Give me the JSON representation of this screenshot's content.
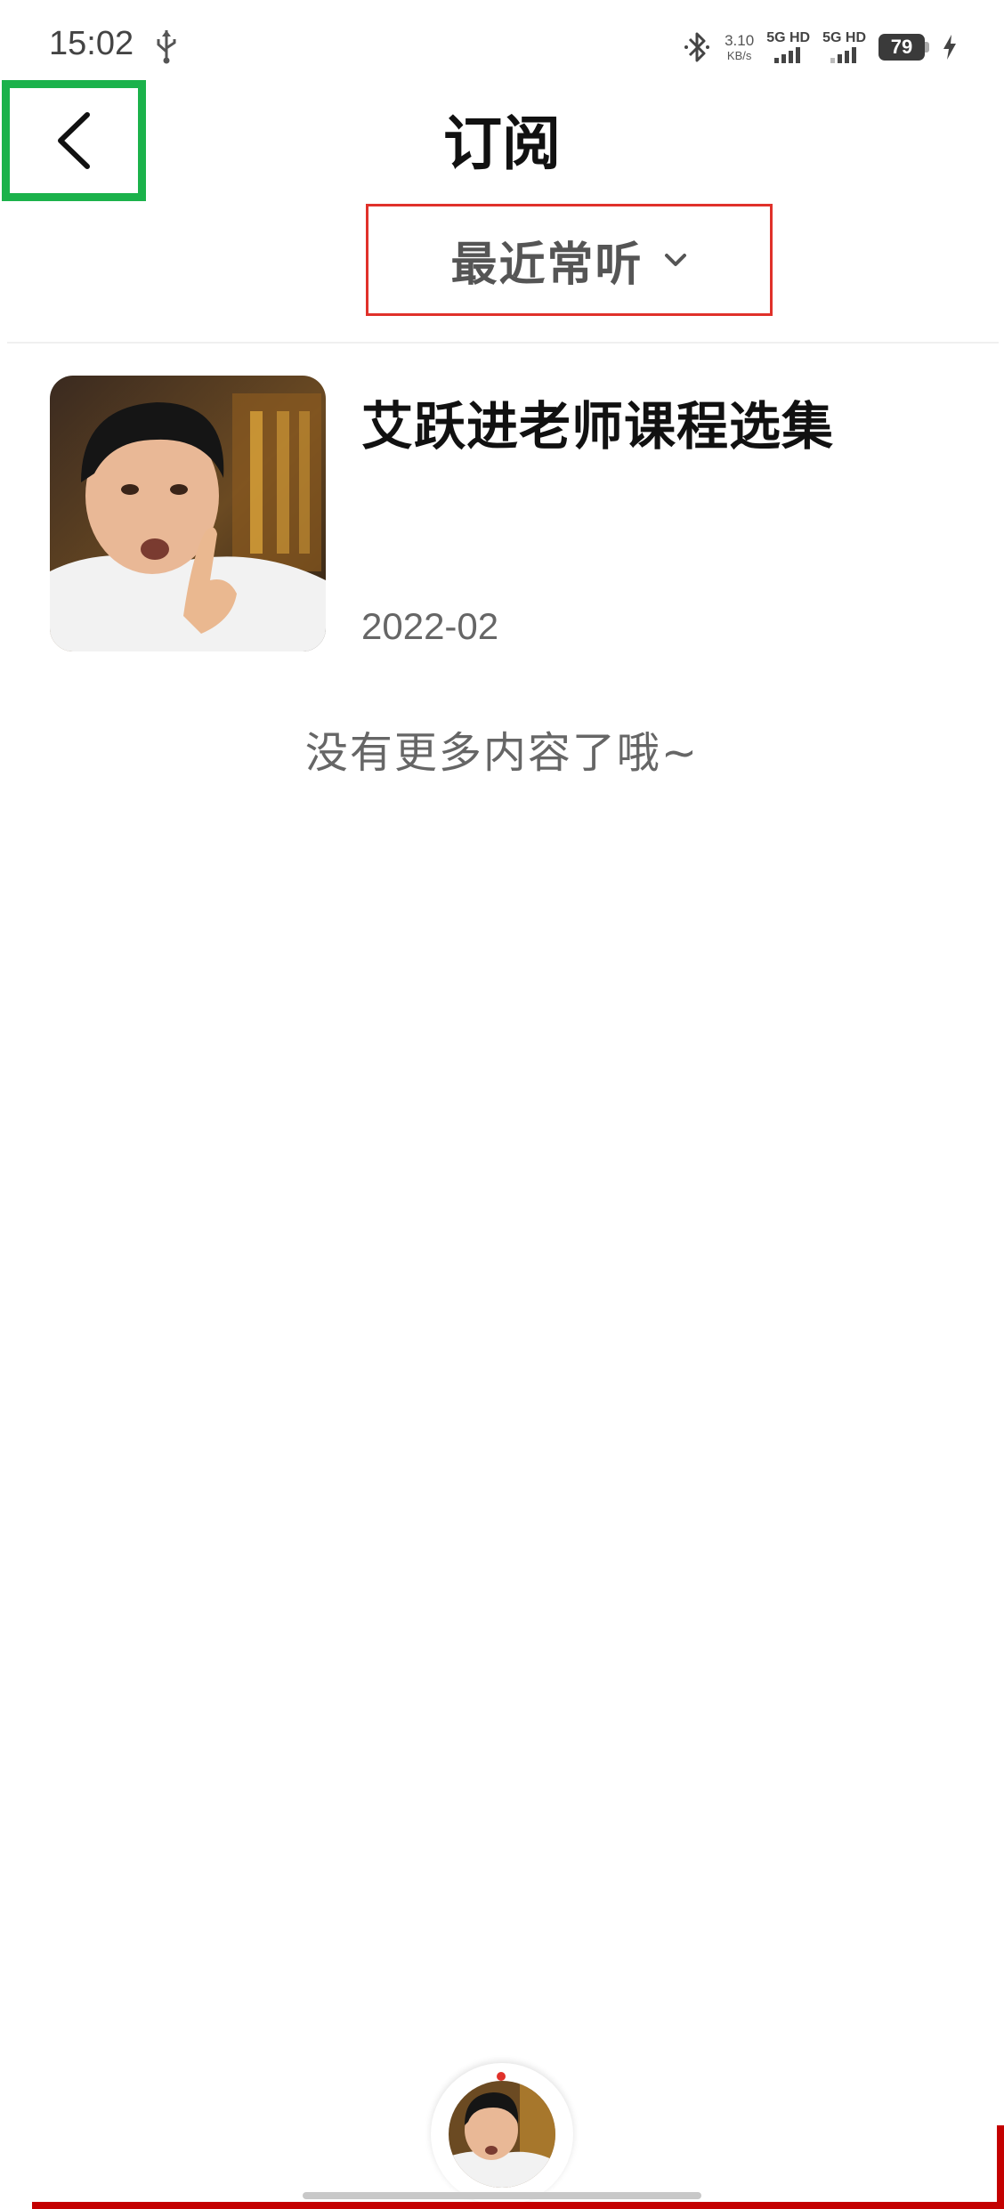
{
  "status_bar": {
    "time": "15:02",
    "net_speed_value": "3.10",
    "net_speed_unit": "KB/s",
    "sim1_label": "5G HD",
    "sim2_label": "5G HD",
    "battery_level": "79",
    "icons": [
      "usb-icon",
      "bluetooth-icon",
      "signal-icon",
      "battery-icon",
      "charging-icon"
    ]
  },
  "header": {
    "title": "订阅",
    "back_icon": "chevron-left-icon"
  },
  "sort": {
    "label": "最近常听",
    "icon": "chevron-down-icon"
  },
  "albums": [
    {
      "title": "艾跃进老师课程选集",
      "date": "2022-02"
    }
  ],
  "end_of_list_text": "没有更多内容了哦~",
  "colors": {
    "highlight_green": "#1bb24b",
    "highlight_red": "#e0312a",
    "brand_red": "#c40000"
  }
}
